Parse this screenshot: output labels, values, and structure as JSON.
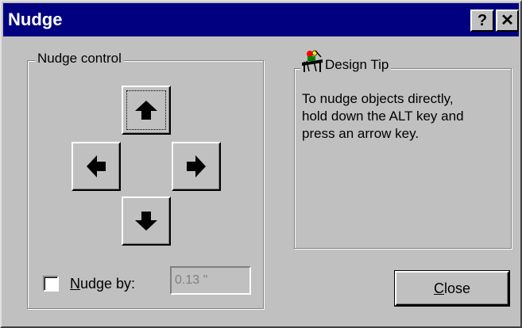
{
  "window": {
    "title": "Nudge",
    "help_button": "?",
    "close_button": "✕"
  },
  "nudge_group": {
    "label": "Nudge control",
    "checkbox_checked": false,
    "checkbox_label_mnemonic": "N",
    "checkbox_label_rest": "udge by:",
    "value": "0.13 \""
  },
  "tip": {
    "label": "Design Tip",
    "lines": [
      "To nudge objects directly,",
      "hold down the ALT key and",
      "press an arrow key."
    ]
  },
  "close": {
    "mnemonic": "C",
    "rest": "lose"
  },
  "icons": {
    "up": "arrow-up-icon",
    "down": "arrow-down-icon",
    "left": "arrow-left-icon",
    "right": "arrow-right-icon",
    "tip": "design-tip-icon"
  }
}
